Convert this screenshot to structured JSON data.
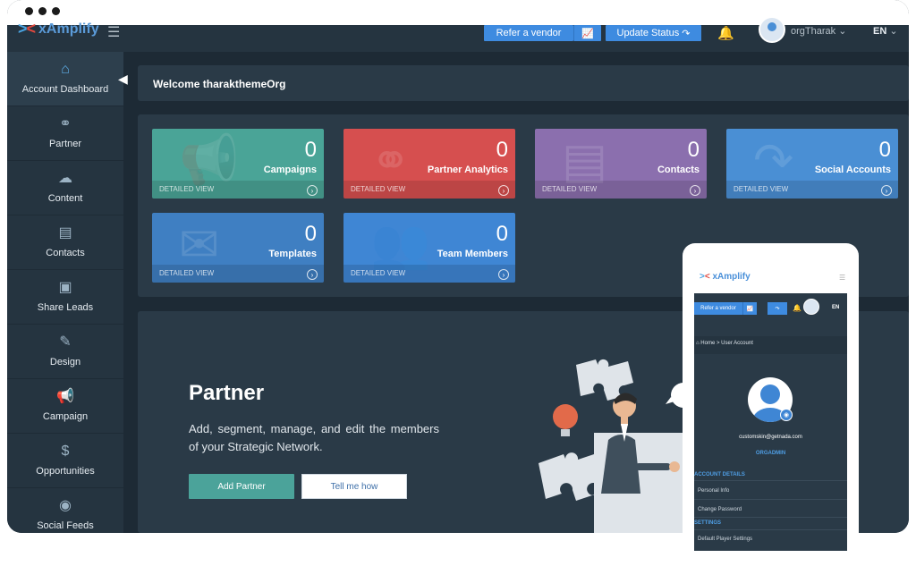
{
  "app": {
    "brand": "xAmplify"
  },
  "topbar": {
    "refer_vendor_label": "Refer a vendor",
    "chart_icon": "chart-line-icon",
    "update_status_label": "Update Status",
    "bell_icon": "bell-icon",
    "user_name": "orgTharak",
    "language": "EN"
  },
  "sidebar": {
    "items": [
      {
        "label": "Account Dashboard",
        "icon": "home-icon",
        "glyph": "⌂",
        "active": true
      },
      {
        "label": "Partner",
        "icon": "handshake-icon",
        "glyph": "⚭"
      },
      {
        "label": "Content",
        "icon": "cloud-upload-icon",
        "glyph": "☁"
      },
      {
        "label": "Contacts",
        "icon": "contact-card-icon",
        "glyph": "▤"
      },
      {
        "label": "Share Leads",
        "icon": "clipboard-user-icon",
        "glyph": "▣"
      },
      {
        "label": "Design",
        "icon": "brush-icon",
        "glyph": "✎"
      },
      {
        "label": "Campaign",
        "icon": "megaphone-icon",
        "glyph": "📢"
      },
      {
        "label": "Opportunities",
        "icon": "money-icon",
        "glyph": "$"
      },
      {
        "label": "Social Feeds",
        "icon": "rss-icon",
        "glyph": "◉"
      }
    ]
  },
  "welcome": {
    "text": "Welcome tharakthemeOrg"
  },
  "cards": [
    {
      "value": "0",
      "label": "Campaigns",
      "footer": "DETAILED VIEW",
      "color": "#4aa497",
      "icon": "megaphone-icon"
    },
    {
      "value": "0",
      "label": "Partner Analytics",
      "footer": "DETAILED VIEW",
      "color": "#d64f4f",
      "icon": "handshake-icon"
    },
    {
      "value": "0",
      "label": "Contacts",
      "footer": "DETAILED VIEW",
      "color": "#8b6fae",
      "icon": "contact-card-icon"
    },
    {
      "value": "0",
      "label": "Social Accounts",
      "footer": "DETAILED VIEW",
      "color": "#4a8fd4",
      "icon": "share-icon"
    },
    {
      "value": "0",
      "label": "Templates",
      "footer": "DETAILED VIEW",
      "color": "#3f7fc2",
      "icon": "envelope-icon"
    },
    {
      "value": "0",
      "label": "Team Members",
      "footer": "DETAILED VIEW",
      "color": "#3f86d4",
      "icon": "users-icon"
    }
  ],
  "partner_section": {
    "title": "Partner",
    "description": "Add, segment, manage, and edit the members of your Strategic Network.",
    "add_button": "Add Partner",
    "tell_button": "Tell me how"
  },
  "phone": {
    "brand": "xAmplify",
    "refer_vendor_label": "Refer a vendor",
    "language": "EN",
    "breadcrumb_home": "Home",
    "breadcrumb_sep": ">",
    "breadcrumb_current": "User Account",
    "email": "customskin@getnada.com",
    "role": "ORGADMIN",
    "section_account": "ACCOUNT DETAILS",
    "link_personal": "Personal Info",
    "link_password": "Change Password",
    "section_settings": "SETTINGS",
    "link_player": "Default Player Settings"
  }
}
